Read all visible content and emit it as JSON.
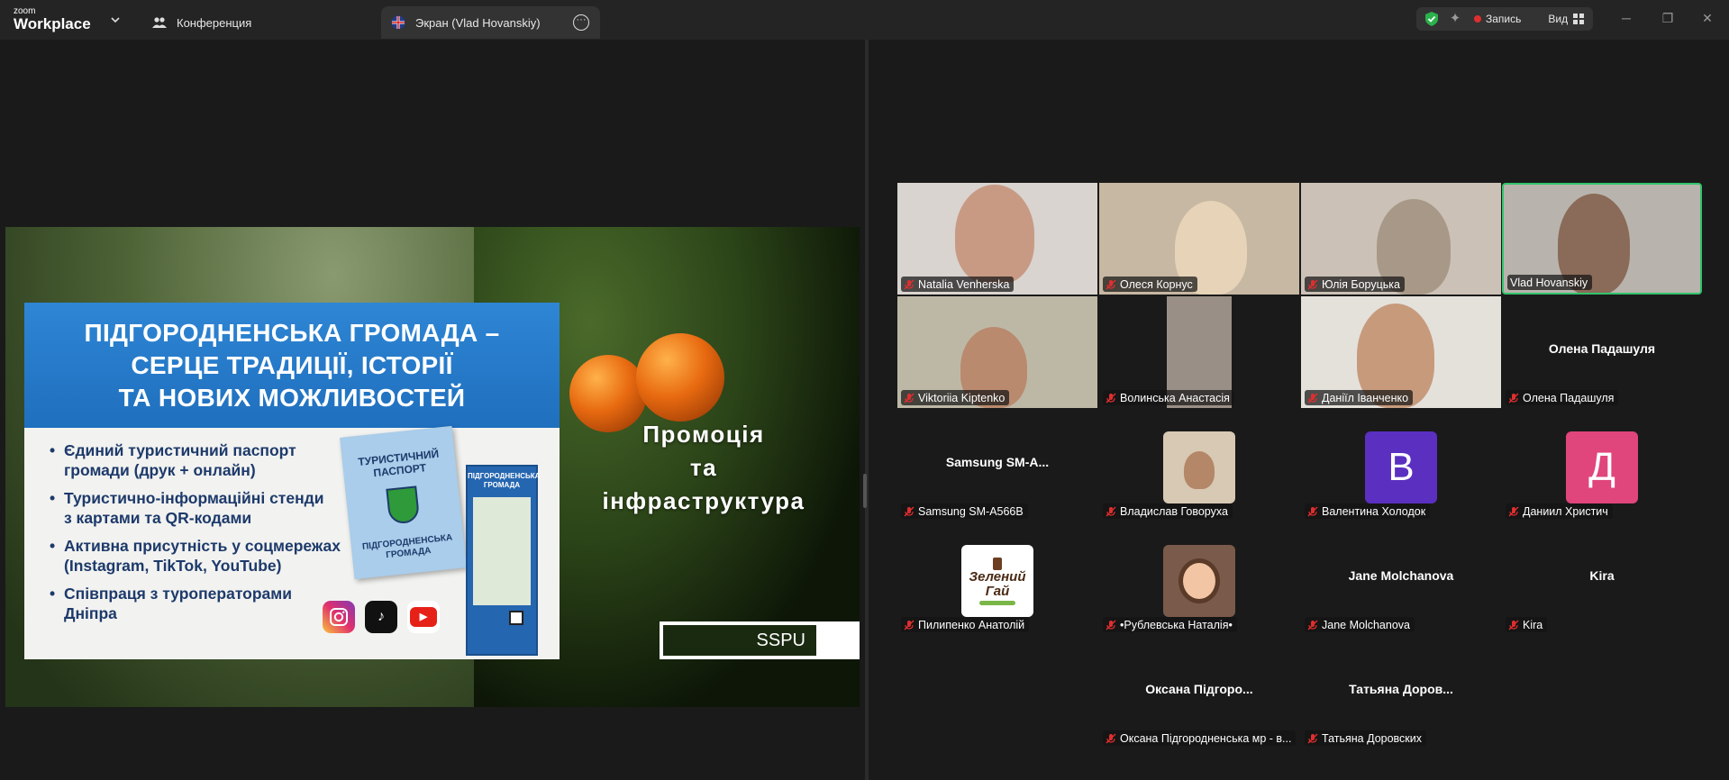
{
  "app": {
    "logo_top": "zoom",
    "logo_main": "Workplace"
  },
  "tabs": [
    {
      "label": "Конференция",
      "icon": "people-icon"
    },
    {
      "label": "Экран (Vlad Hovanskiy)",
      "icon": "uk-flag-icon"
    }
  ],
  "toolbar": {
    "record_label": "Запись",
    "view_label": "Вид"
  },
  "slide": {
    "heading_lines": [
      "ПІДГОРОДНЕНСЬКА ГРОМАДА –",
      "СЕРЦЕ ТРАДИЦІЇ, ІСТОРІЇ",
      "ТА НОВИХ МОЖЛИВОСТЕЙ"
    ],
    "bullets": [
      "Єдиний туристичний паспорт\nгромади (друк + онлайн)",
      "Туристично-інформаційні стенди\nз картами та QR-кодами",
      "Активна присутність у соцмережах\n(Instagram, TikTok, YouTube)",
      "Співпраця з туроператорами\nДніпра"
    ],
    "passport_title": "ТУРИСТИЧНИЙ\nПАСПОРТ",
    "passport_sub": "ПІДГОРОДНЕНСЬКА\nГРОМАДА",
    "stand_title": "ПІДГОРОДНЕНСЬКА\nГРОМАДА",
    "promo_lines": [
      "Промоція",
      "та",
      "інфраструктура"
    ],
    "sspu": "SSPU"
  },
  "participants": [
    {
      "name": "Natalia Venherska",
      "video": true,
      "muted": true
    },
    {
      "name": "Олеся Корнус",
      "video": true,
      "muted": true
    },
    {
      "name": "Юлія Боруцька",
      "video": true,
      "muted": true
    },
    {
      "name": "Vlad Hovanskiy",
      "video": true,
      "muted": false,
      "active": true
    },
    {
      "name": "Viktoriia Kiptenko",
      "video": true,
      "muted": true
    },
    {
      "name": "Волинська Анастасія",
      "video": true,
      "muted": true
    },
    {
      "name": "Даніїл Іванченко",
      "video": true,
      "muted": true
    },
    {
      "name": "Олена Падашуля",
      "center": "Олена Падашуля",
      "muted": true
    },
    {
      "name": "Samsung SM-A566B",
      "center": "Samsung  SM-A...",
      "muted": true
    },
    {
      "name": "Владислав Говоруха",
      "avatar": "photo",
      "muted": true
    },
    {
      "name": "Валентина Холодок",
      "avatar": "letter",
      "letter": "В",
      "color": "#5b2fc0",
      "muted": true
    },
    {
      "name": "Даниил Христич",
      "avatar": "letter",
      "letter": "Д",
      "color": "#e0457b",
      "muted": true
    },
    {
      "name": "Пилипенко Анатолій",
      "avatar": "logo",
      "logo_text": "Зелений Гай",
      "muted": true
    },
    {
      "name": "•Рублевська Наталія•",
      "avatar": "cartoon",
      "muted": true
    },
    {
      "name": "Jane Molchanova",
      "center": "Jane Molchanova",
      "muted": true
    },
    {
      "name": "Kira",
      "center": "Kira",
      "muted": true
    },
    {
      "name": "Оксана Підгородненська мр - в...",
      "center": "Оксана  Підгоро...",
      "muted": true
    },
    {
      "name": "Татьяна Доровских",
      "center": "Татьяна  Доров...",
      "muted": true
    }
  ],
  "colors": {
    "active_border": "#31c36b",
    "record_dot": "#e02e2e",
    "slide_blue": "#2e86d4"
  }
}
